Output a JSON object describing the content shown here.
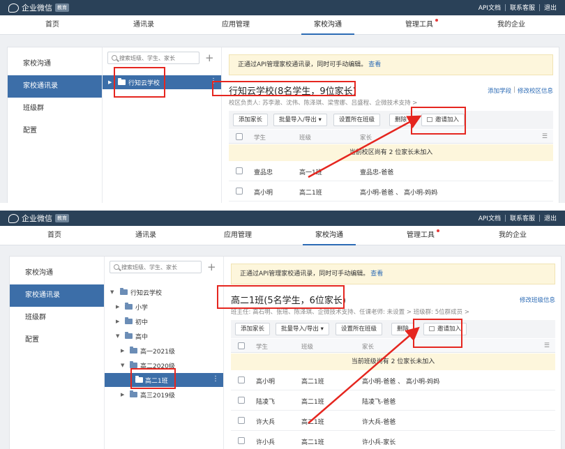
{
  "topbar": {
    "logo_text": "企业微信",
    "edu_badge": "教育",
    "links": [
      "API文档",
      "联系客服",
      "退出"
    ]
  },
  "nav": {
    "items": [
      "首页",
      "通讯录",
      "应用管理",
      "家校沟通",
      "管理工具",
      "我的企业"
    ],
    "active": "家校沟通"
  },
  "left_menu": {
    "items": [
      "家校沟通",
      "家校通讯录",
      "班级群",
      "配置"
    ],
    "active": "家校通讯录"
  },
  "search": {
    "placeholder": "搜索班级、学生、家长"
  },
  "notice": {
    "text": "正通过API管理家校通讯录，同时可手动编辑。",
    "link": "查看"
  },
  "toolbar": {
    "add_parent": "添加家长",
    "bulk_import_export": "批量导入/导出 ▾",
    "set_class": "设置所在班级",
    "delete": "删除",
    "invite": "邀请加入"
  },
  "columns": {
    "student": "学生",
    "class": "班级",
    "parent": "家长"
  },
  "panel1": {
    "tree": [
      {
        "label": "行知云学校"
      }
    ],
    "title": "行知云学校(8名学生，9位家长)",
    "right_links": [
      "添加学段",
      "修改校区信息"
    ],
    "sub_info": "校区负责人: 苏李澈、沈伟、陈泽琪、梁雪娜、吕盛程、企微技术支持 >",
    "pending": "当前校区尚有 2 位家长未加入",
    "rows": [
      {
        "student": "壹品忠",
        "class": "高一1班",
        "parent": "壹品忠-爸爸"
      },
      {
        "student": "高小明",
        "class": "高二1班",
        "parent": "高小明-爸爸 、 高小明-妈妈"
      }
    ]
  },
  "panel2": {
    "tree": [
      {
        "label": "行知云学校",
        "arrow": "▼"
      },
      {
        "label": "小学",
        "arrow": "▶"
      },
      {
        "label": "初中",
        "arrow": "▶"
      },
      {
        "label": "高中",
        "arrow": "▼"
      },
      {
        "label": "高一2021级",
        "arrow": "▶"
      },
      {
        "label": "高二2020级",
        "arrow": "▼"
      },
      {
        "label": "高二1班",
        "arrow": ""
      },
      {
        "label": "高三2019级",
        "arrow": "▶"
      }
    ],
    "title": "高二1班(5名学生，6位家长)",
    "right_links": [
      "修改班级信息"
    ],
    "sub_info": "班主任: 高石明、张瑶、陈泽琪、企微技术支持、任课老师: 未设置 >    班级群: 5位群成员 >",
    "pending": "当前班级尚有 2 位家长未加入",
    "rows": [
      {
        "student": "高小明",
        "class": "高二1班",
        "parent": "高小明-爸爸 、 高小明-妈妈"
      },
      {
        "student": "陆凌飞",
        "class": "高二1班",
        "parent": "陆凌飞-爸爸"
      },
      {
        "student": "许大兵",
        "class": "高二1班",
        "parent": "许大兵-爸爸"
      },
      {
        "student": "许小兵",
        "class": "高二1班",
        "parent": "许小兵-家长"
      }
    ]
  },
  "colors": {
    "topbar": "#2a4158",
    "accent": "#3c6ea8",
    "annotation": "#e5261f",
    "notice_bg": "#fdf6dc"
  }
}
